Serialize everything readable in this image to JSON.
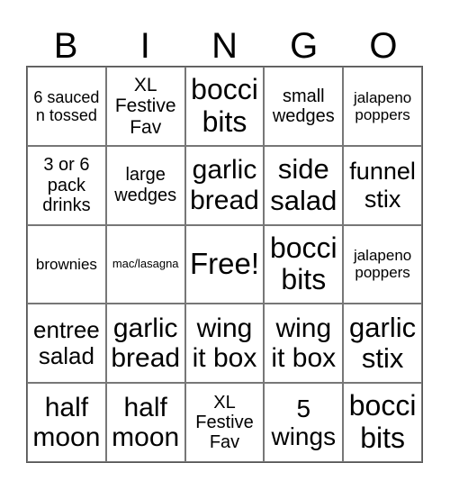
{
  "header": {
    "letters": [
      "B",
      "I",
      "N",
      "G",
      "O"
    ]
  },
  "cells": [
    {
      "text": "6 sauced n tossed",
      "size": "md"
    },
    {
      "text": "XL Festive Fav",
      "size": "lg"
    },
    {
      "text": "bocci bits",
      "size": "xl"
    },
    {
      "text": "small wedges",
      "size": "lg"
    },
    {
      "text": "jalapeno poppers",
      "size": "sm"
    },
    {
      "text": "3 or 6 pack drinks",
      "size": "lg"
    },
    {
      "text": "large wedges",
      "size": "lg"
    },
    {
      "text": "garlic bread",
      "size": "xl"
    },
    {
      "text": "side salad",
      "size": "xl"
    },
    {
      "text": "funnel stix",
      "size": "xxl"
    },
    {
      "text": "brownies",
      "size": "sm"
    },
    {
      "text": "mac/lasagna",
      "size": "xs"
    },
    {
      "text": "Free!",
      "size": "xl"
    },
    {
      "text": "bocci bits",
      "size": "xl"
    },
    {
      "text": "jalapeno poppers",
      "size": "sm"
    },
    {
      "text": "entree salad",
      "size": "xxl"
    },
    {
      "text": "garlic bread",
      "size": "xl"
    },
    {
      "text": "wing it box",
      "size": "xl"
    },
    {
      "text": "wing it box",
      "size": "xl"
    },
    {
      "text": "garlic stix",
      "size": "xl"
    },
    {
      "text": "half moon",
      "size": "xl"
    },
    {
      "text": "half moon",
      "size": "xl"
    },
    {
      "text": "XL Festive Fav",
      "size": "lg"
    },
    {
      "text": "5 wings",
      "size": "xxl"
    },
    {
      "text": "bocci bits",
      "size": "xl"
    }
  ]
}
